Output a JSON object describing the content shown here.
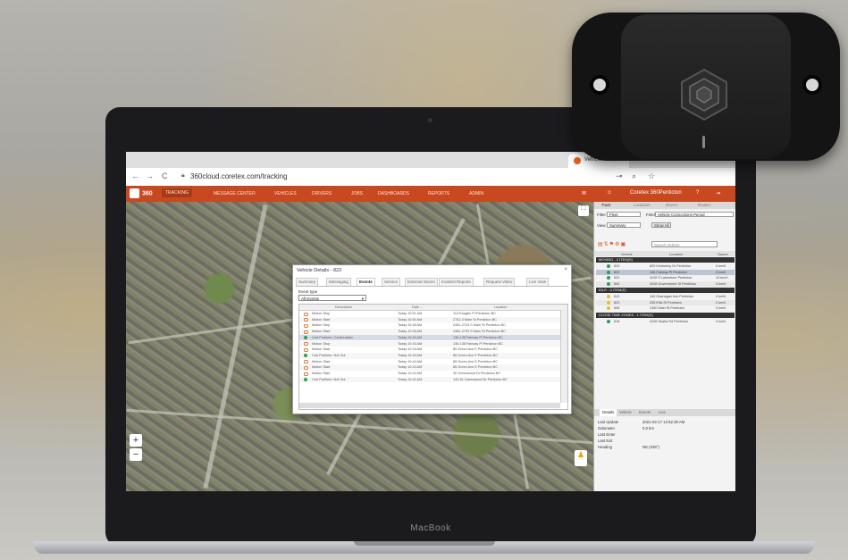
{
  "browser": {
    "tab_title": "Vehicle Trac",
    "url": "360cloud.coretex.com/tracking",
    "back_icon": "arrow-left-icon",
    "forward_icon": "arrow-right-icon",
    "reload_icon": "reload-icon"
  },
  "nav": {
    "logo": "360",
    "items": [
      "TRACKING",
      "MESSAGE CENTER",
      "VEHICLES",
      "DRIVERS",
      "JOBS",
      "DASHBOARDS",
      "REPORTS",
      "ADMIN"
    ],
    "user": "Coretex 360Penticton"
  },
  "dialog": {
    "title": "Vehicle Details - 822",
    "close": "×",
    "tabs": [
      "Summary",
      "Messaging",
      "Events",
      "Service",
      "External Stores",
      "Incident Reports",
      "Request Video",
      "Live View"
    ],
    "event_type_label": "Event type",
    "event_type_value": "All Events",
    "columns": [
      "Description",
      "Date ↓",
      "Location"
    ],
    "rows": [
      {
        "desc": "Motion Stop",
        "date": "Today 10:51 AM",
        "loc": "113 Eaughn Pl Penticton BC",
        "icon": "motion"
      },
      {
        "desc": "Motion Start",
        "date": "Today 10:50 AM",
        "loc": "2702-3 Main St Penticton BC",
        "icon": "motion"
      },
      {
        "desc": "Motion Stop",
        "date": "Today 10:48 AM",
        "loc": "2481-2703 S Main St Penticton BC",
        "icon": "motion"
      },
      {
        "desc": "Motion Start",
        "date": "Today 10:46 AM",
        "loc": "2481-2703 S Main St Penticton BC",
        "icon": "motion"
      },
      {
        "desc": "Cart Problem: Continuation",
        "date": "Today 10:44 AM",
        "loc": "136-138 Fairway Pl Penticton BC",
        "icon": "dot"
      },
      {
        "desc": "Motion Stop",
        "date": "Today 10:43 AM",
        "loc": "136-138 Fairway Pl Penticton BC",
        "icon": "motion"
      },
      {
        "desc": "Motion Start",
        "date": "Today 10:43 AM",
        "loc": "85 Green Ave E Penticton BC",
        "icon": "motion"
      },
      {
        "desc": "Cart Problem: Not Out",
        "date": "Today 10:44 AM",
        "loc": "85 Green Ave E Penticton BC",
        "icon": "dot"
      },
      {
        "desc": "Motion Start",
        "date": "Today 10:44 AM",
        "loc": "85 Green Ave E Penticton BC",
        "icon": "motion"
      },
      {
        "desc": "Motion Start",
        "date": "Today 10:43 AM",
        "loc": "85 Green Ave E Penticton BC",
        "icon": "motion"
      },
      {
        "desc": "Motion Start",
        "date": "Today 10:42 AM",
        "loc": "30 Greenwood Dr Penticton BC",
        "icon": "motion"
      },
      {
        "desc": "Cart Problem: Not Out",
        "date": "Today 10:42 AM",
        "loc": "149-51 Greenwood Dr Penticton BC",
        "icon": "dot"
      }
    ]
  },
  "panel": {
    "tabs": [
      "Track",
      "Locations",
      "Drivers",
      "Routes"
    ],
    "filter_label": "Filter",
    "filter_value": "Fleet",
    "field_label": "Field",
    "field_value": "Vehicle Connections Period",
    "view_label": "View",
    "view_value": "Summary",
    "show_all": "Show All",
    "search_placeholder": "Search Vehicle",
    "headers": [
      "Vehicle",
      "Location",
      "Speed"
    ],
    "groups": [
      {
        "name": "MOVING - 4 ITEM(S)",
        "color": "#2f9c5b",
        "rows": [
          {
            "id": "810",
            "loc": "829 Kimberley Dr Penticton",
            "speed": "0 km/h"
          },
          {
            "id": "822",
            "loc": "136 Fairway Pl Penticton",
            "speed": "0 km/h"
          },
          {
            "id": "831",
            "loc": "1100 S Lakeshore Penticton",
            "speed": "14 km/h"
          },
          {
            "id": "840",
            "loc": "2008 Government St Penticton",
            "speed": "0 km/h"
          }
        ]
      },
      {
        "name": "IDLE - 3 ITEM(S)",
        "color": "#e0c030",
        "rows": [
          {
            "id": "812",
            "loc": "140 Okanagan Ave Penticton",
            "speed": "0 km/h"
          },
          {
            "id": "823",
            "loc": "335 Ellis St Penticton",
            "speed": "0 km/h"
          },
          {
            "id": "845",
            "loc": "2450 Main St Penticton",
            "speed": "0 km/h"
          }
        ]
      },
      {
        "name": "CLOSE TIME ZONES - 1 ITEM(S)",
        "color": "#2f9c5b",
        "rows": [
          {
            "id": "818",
            "loc": "3106 Skaha Rd Penticton",
            "speed": "0 km/h"
          }
        ]
      }
    ],
    "detail_tabs": [
      "Details",
      "Vehicle",
      "Events",
      "Live"
    ],
    "details": [
      {
        "k": "Last Update",
        "v": "2021-04-17 12:52:39 AM"
      },
      {
        "k": "Odometer",
        "v": "0.0 km"
      },
      {
        "k": "Last Enter",
        "v": ""
      },
      {
        "k": "Last Exit",
        "v": ""
      },
      {
        "k": "Heading",
        "v": "NE (039°)"
      }
    ]
  },
  "map": {
    "zoom_in": "+",
    "zoom_out": "−",
    "pegman": "♟",
    "fullscreen": "⛶"
  },
  "laptop": {
    "brand": "MacBook"
  }
}
